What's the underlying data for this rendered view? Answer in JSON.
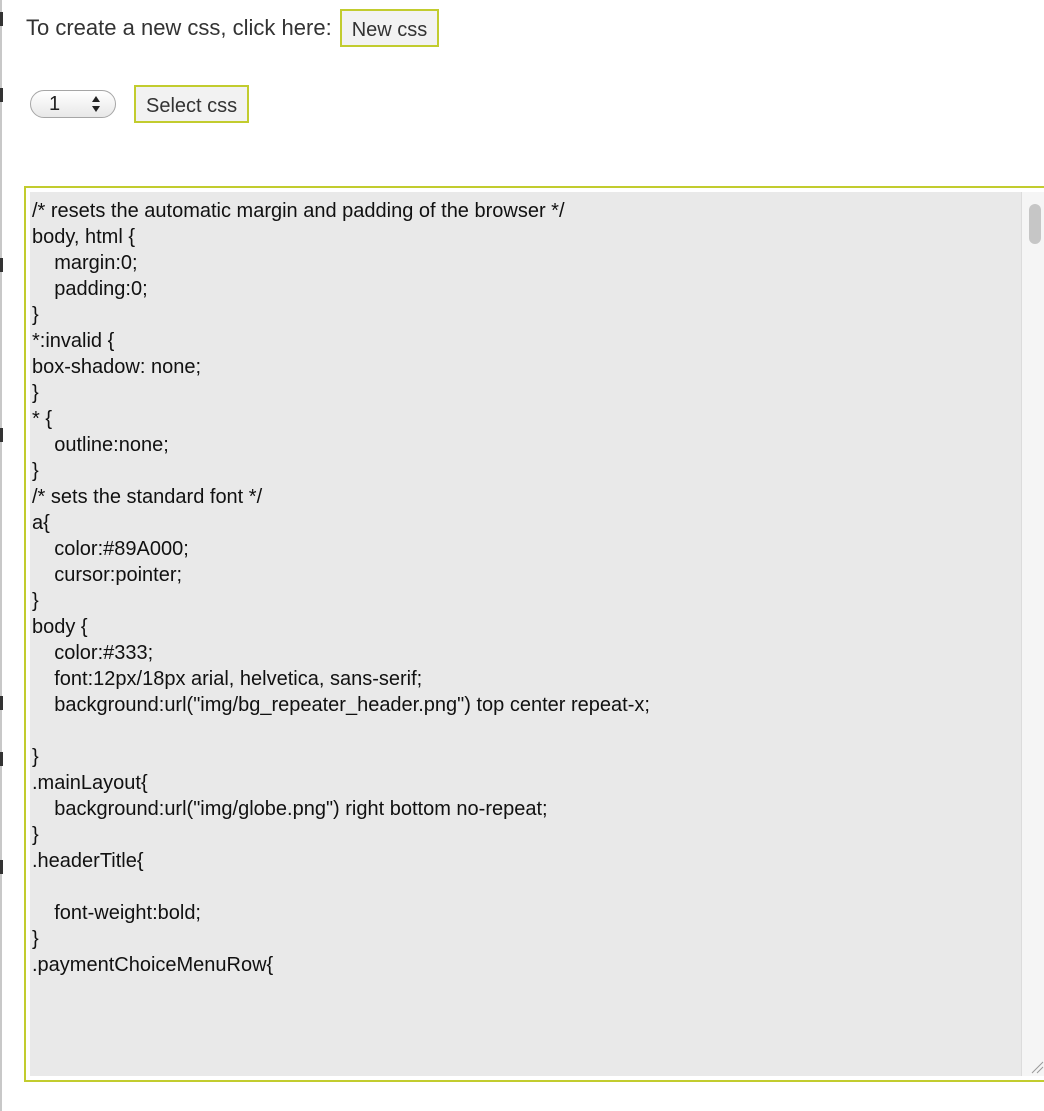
{
  "header": {
    "intro_text": "To create a new css, click here:",
    "new_css_label": "New css"
  },
  "selector": {
    "selected_value": "1",
    "select_css_label": "Select css"
  },
  "editor": {
    "lines": [
      "/* resets the automatic margin and padding of the browser */",
      "body, html {",
      "\tmargin:0;",
      "\tpadding:0;",
      "}",
      "*:invalid {",
      "box-shadow: none;",
      "}",
      "* {",
      "\toutline:none;",
      "}",
      "/* sets the standard font */",
      "a{",
      "\tcolor:#89A000;",
      "\tcursor:pointer;",
      "}",
      "body {",
      "\tcolor:#333;",
      "\tfont:12px/18px arial, helvetica, sans-serif;",
      "\tbackground:url(\"img/bg_repeater_header.png\") top center repeat-x;",
      "",
      "}",
      ".mainLayout{",
      "\tbackground:url(\"img/globe.png\") right bottom no-repeat;",
      "}",
      ".headerTitle{",
      "",
      "\tfont-weight:bold;",
      "}",
      ".paymentChoiceMenuRow{"
    ]
  },
  "colors": {
    "accent_border": "#c2cc2e",
    "editor_bg": "#e9e9e9"
  }
}
